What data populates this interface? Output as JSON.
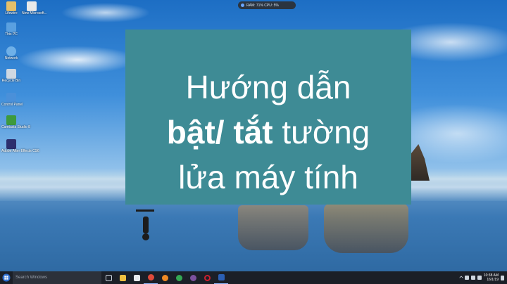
{
  "desktop": {
    "icons": [
      {
        "label": "Lifewire",
        "color": "#e5c06a"
      },
      {
        "label": "New Microsoft...",
        "color": "#e9e9e9"
      },
      {
        "label": "This PC",
        "color": "#5aa0e0"
      },
      {
        "label": "Network",
        "color": "#6fb0e8"
      },
      {
        "label": "Recycle Bin",
        "color": "#cfd8e2"
      },
      {
        "label": "Control Panel",
        "color": "#4a90d9"
      },
      {
        "label": "Camtasia Studio 8",
        "color": "#3d9a3d"
      },
      {
        "label": "Adobe After Effects CS6",
        "color": "#2c2f6e"
      }
    ]
  },
  "monitor": {
    "text": "RAM: 71%  CPU: 5%"
  },
  "card": {
    "line1": "Hướng dẫn",
    "line2_bold": "bật/ tắt",
    "line2_rest": " tường",
    "line3": "lửa máy tính"
  },
  "taskbar": {
    "search_placeholder": "Search Windows",
    "apps": [
      {
        "name": "task-view",
        "color": "#c9d1db"
      },
      {
        "name": "file-explorer",
        "color": "#f0c040"
      },
      {
        "name": "store",
        "color": "#e8eaed"
      },
      {
        "name": "chrome",
        "color": "#e04a3a"
      },
      {
        "name": "firefox",
        "color": "#f08a24"
      },
      {
        "name": "chrome-alt",
        "color": "#34a853"
      },
      {
        "name": "viber",
        "color": "#7b519d"
      },
      {
        "name": "opera",
        "color": "#cc1f2f"
      },
      {
        "name": "word",
        "color": "#2b5fb4"
      }
    ],
    "time": "10:38 AM",
    "date": "16/1/19"
  }
}
